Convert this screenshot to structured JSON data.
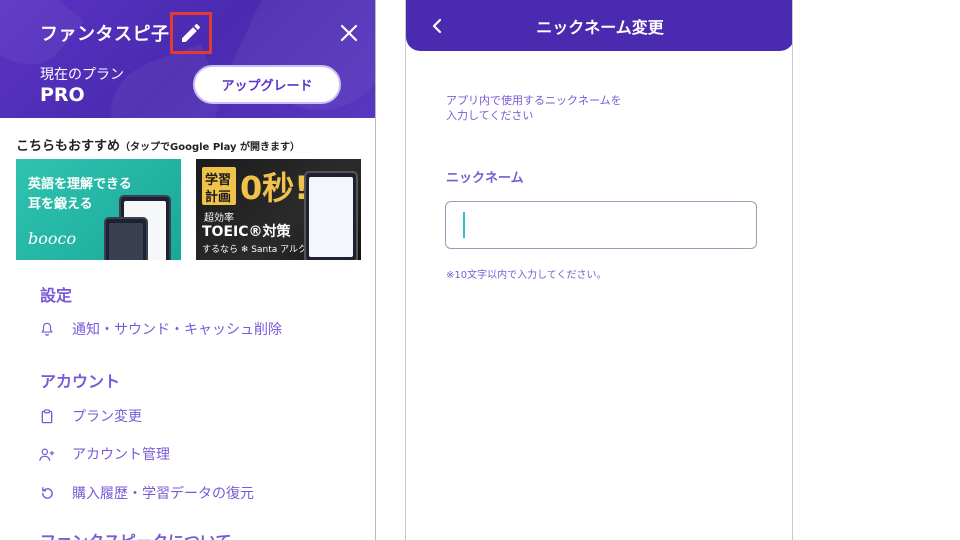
{
  "menu_panel": {
    "user_name": "ファンタスピ子",
    "plan_label": "現在のプラン",
    "plan_name": "PRO",
    "upgrade_label": "アップグレード",
    "recommend_title": "こちらもおすすめ",
    "recommend_note": "（タップでGoogle Play が開きます）",
    "banners": {
      "booco": {
        "line1": "英語を理解できる",
        "line2": "耳を鍛える",
        "logo": "booco"
      },
      "santa": {
        "line1": "学習",
        "line2": "計画",
        "big": "0秒!",
        "sub": "超効率",
        "toeic": "TOEIC®対策",
        "footer": "するなら ❄ Santa アルク"
      }
    },
    "sections": [
      {
        "title": "設定",
        "items": [
          {
            "label": "通知・サウンド・キャッシュ削除",
            "icon": "bell-icon"
          }
        ]
      },
      {
        "title": "アカウント",
        "items": [
          {
            "label": "プラン変更",
            "icon": "clipboard-icon"
          },
          {
            "label": "アカウント管理",
            "icon": "user-add-icon"
          },
          {
            "label": "購入履歴・学習データの復元",
            "icon": "restore-icon"
          }
        ]
      },
      {
        "title": "ファンタスピークについて",
        "items": []
      }
    ]
  },
  "nickname_screen": {
    "title": "ニックネーム変更",
    "description": "アプリ内で使用するニックネームを\n入力してください",
    "field_label": "ニックネーム",
    "field_value": "",
    "field_placeholder": "",
    "hint": "※10文字以内で入力してください。"
  },
  "colors": {
    "header_purple": "#4a2bb0",
    "accent_purple": "#7a5ad6",
    "edit_highlight": "#e53935",
    "caret_teal": "#2bc4c0"
  }
}
